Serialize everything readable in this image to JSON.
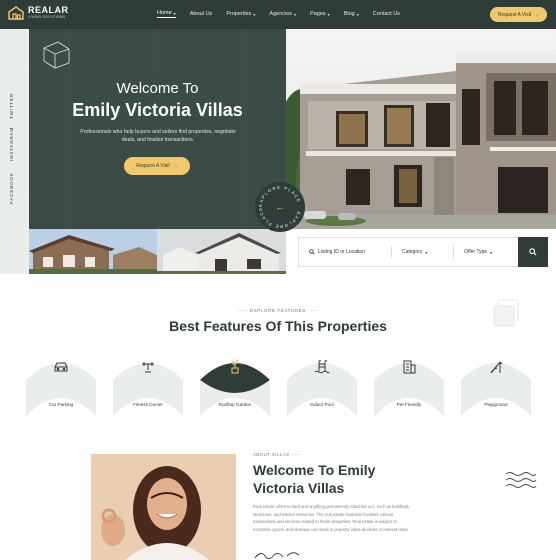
{
  "brand": {
    "name": "REALAR",
    "tagline": "LIVING SOLUTIONS"
  },
  "nav": [
    {
      "label": "Home",
      "has_dropdown": true,
      "active": true
    },
    {
      "label": "About Us",
      "has_dropdown": false
    },
    {
      "label": "Properties",
      "has_dropdown": true
    },
    {
      "label": "Agencies",
      "has_dropdown": true
    },
    {
      "label": "Pages",
      "has_dropdown": true
    },
    {
      "label": "Blog",
      "has_dropdown": true
    },
    {
      "label": "Contact Us",
      "has_dropdown": false
    }
  ],
  "header_button": {
    "label": "Request A Visit",
    "icon": "arrow-right-icon"
  },
  "social": [
    {
      "label": "TWITTER"
    },
    {
      "label": "INSTAGRAM"
    },
    {
      "label": "FACEBOOK"
    }
  ],
  "hero": {
    "title_line1": "Welcome To",
    "title_line2": "Emily Victoria Villas",
    "description": "Professionals who help buyers and sellers find properties, negotiate deals, and finalize transactions.",
    "button_label": "Request A Visit",
    "badge_text": "EXPLORE PLACE · EXPLORE PLACE ·"
  },
  "search": {
    "location_placeholder": "Listing ID or Location",
    "category_label": "Category",
    "offer_type_label": "Offer Type",
    "search_icon": "search-icon"
  },
  "features": {
    "eyebrow": "EXPLORE FEATURES",
    "title": "Best Features Of This Properties",
    "items": [
      {
        "label": "Car Parking",
        "icon": "car-icon",
        "highlighted": false
      },
      {
        "label": "Fitness Center",
        "icon": "dumbbell-icon",
        "highlighted": false
      },
      {
        "label": "Rooftop Garden",
        "icon": "plant-icon",
        "highlighted": true
      },
      {
        "label": "Indoor Pool",
        "icon": "pool-icon",
        "highlighted": false
      },
      {
        "label": "Pet Friendly",
        "icon": "building-icon",
        "highlighted": false
      },
      {
        "label": "Playground",
        "icon": "slide-icon",
        "highlighted": false
      }
    ]
  },
  "about": {
    "eyebrow": "ABOUT VILLAS",
    "title_line1": "Welcome To Emily",
    "title_line2": "Victoria Villas",
    "body": "Real estate refers to land and anything permanently attached to it, such as buildings, structures, and natural resources. The real estate business involves various transactions and services related to these properties. Real estate is subject to economic cycles, and demand can result in property value declines or interest rates."
  },
  "colors": {
    "primary": "#2f3c37",
    "accent": "#f2c96a",
    "light": "#e9eeeb"
  }
}
